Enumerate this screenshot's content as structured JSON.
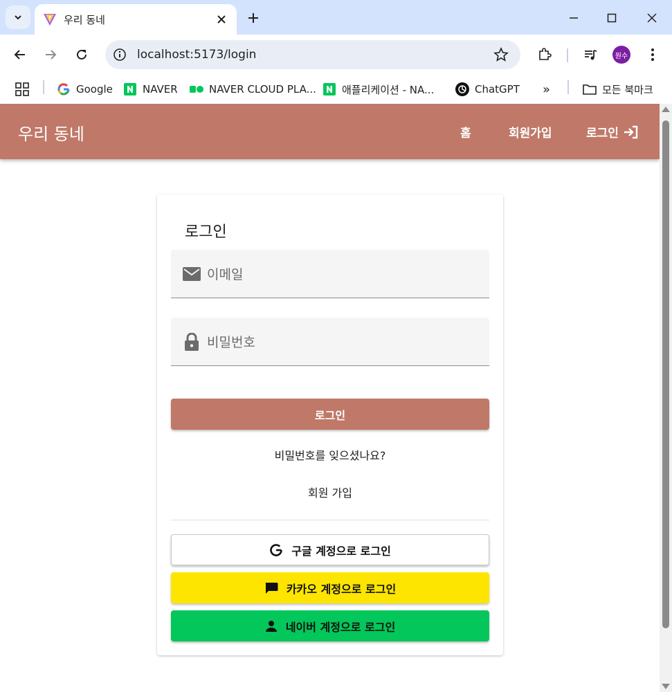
{
  "browser": {
    "tab_title": "우리 동네",
    "url": "localhost:5173/login",
    "profile_label": "원수",
    "bookmarks": [
      {
        "label": "Google",
        "icon": "google-icon"
      },
      {
        "label": "NAVER",
        "icon": "naver-icon"
      },
      {
        "label": "NAVER CLOUD PLA...",
        "icon": "naver-cloud-icon"
      },
      {
        "label": "애플리케이션 - NA...",
        "icon": "naver-icon"
      },
      {
        "label": "ChatGPT",
        "icon": "chatgpt-icon"
      }
    ],
    "bookmarks_overflow": "»",
    "all_bookmarks": "모든 북마크"
  },
  "app": {
    "brand": "우리 동네",
    "nav": {
      "home": "홈",
      "signup": "회원가입",
      "login": "로그인"
    }
  },
  "login": {
    "title": "로그인",
    "email_placeholder": "이메일",
    "password_placeholder": "비밀번호",
    "submit": "로그인",
    "forgot": "비밀번호를 잊으셨나요?",
    "signup": "회원 가입",
    "google": "구글 계정으로 로그인",
    "kakao": "카카오 계정으로 로그인",
    "naver": "네이버 계정으로 로그인"
  },
  "colors": {
    "primary": "#c07868",
    "kakao": "#fee500",
    "naver": "#03c75a"
  }
}
